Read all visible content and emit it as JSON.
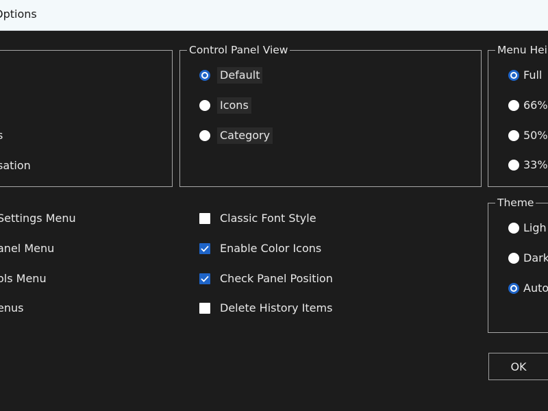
{
  "window": {
    "title": "Options"
  },
  "left_group": {
    "items": [
      "s",
      "sation"
    ]
  },
  "left_options": [
    "Settings Menu",
    "anel Menu",
    "ols Menu",
    "enus"
  ],
  "control_panel_view": {
    "legend": "Control Panel View",
    "options": [
      {
        "label": "Default",
        "selected": true
      },
      {
        "label": "Icons",
        "selected": false
      },
      {
        "label": "Category",
        "selected": false
      }
    ]
  },
  "checkboxes": [
    {
      "label": "Classic Font Style",
      "checked": false
    },
    {
      "label": "Enable Color Icons",
      "checked": true
    },
    {
      "label": "Check Panel Position",
      "checked": true
    },
    {
      "label": "Delete History Items",
      "checked": false
    }
  ],
  "menu_height": {
    "legend": "Menu Hei",
    "options": [
      {
        "label": "Full",
        "selected": true
      },
      {
        "label": "66%",
        "selected": false
      },
      {
        "label": "50%",
        "selected": false
      },
      {
        "label": "33%",
        "selected": false
      }
    ]
  },
  "theme": {
    "legend": "Theme",
    "options": [
      {
        "label": "Ligh",
        "selected": false
      },
      {
        "label": "Dark",
        "selected": false
      },
      {
        "label": "Auto",
        "selected": true
      }
    ]
  },
  "buttons": {
    "ok": "OK"
  },
  "colors": {
    "accent": "#1e64c8",
    "background": "#1c1c1c",
    "titlebar": "#f3f9fb"
  }
}
